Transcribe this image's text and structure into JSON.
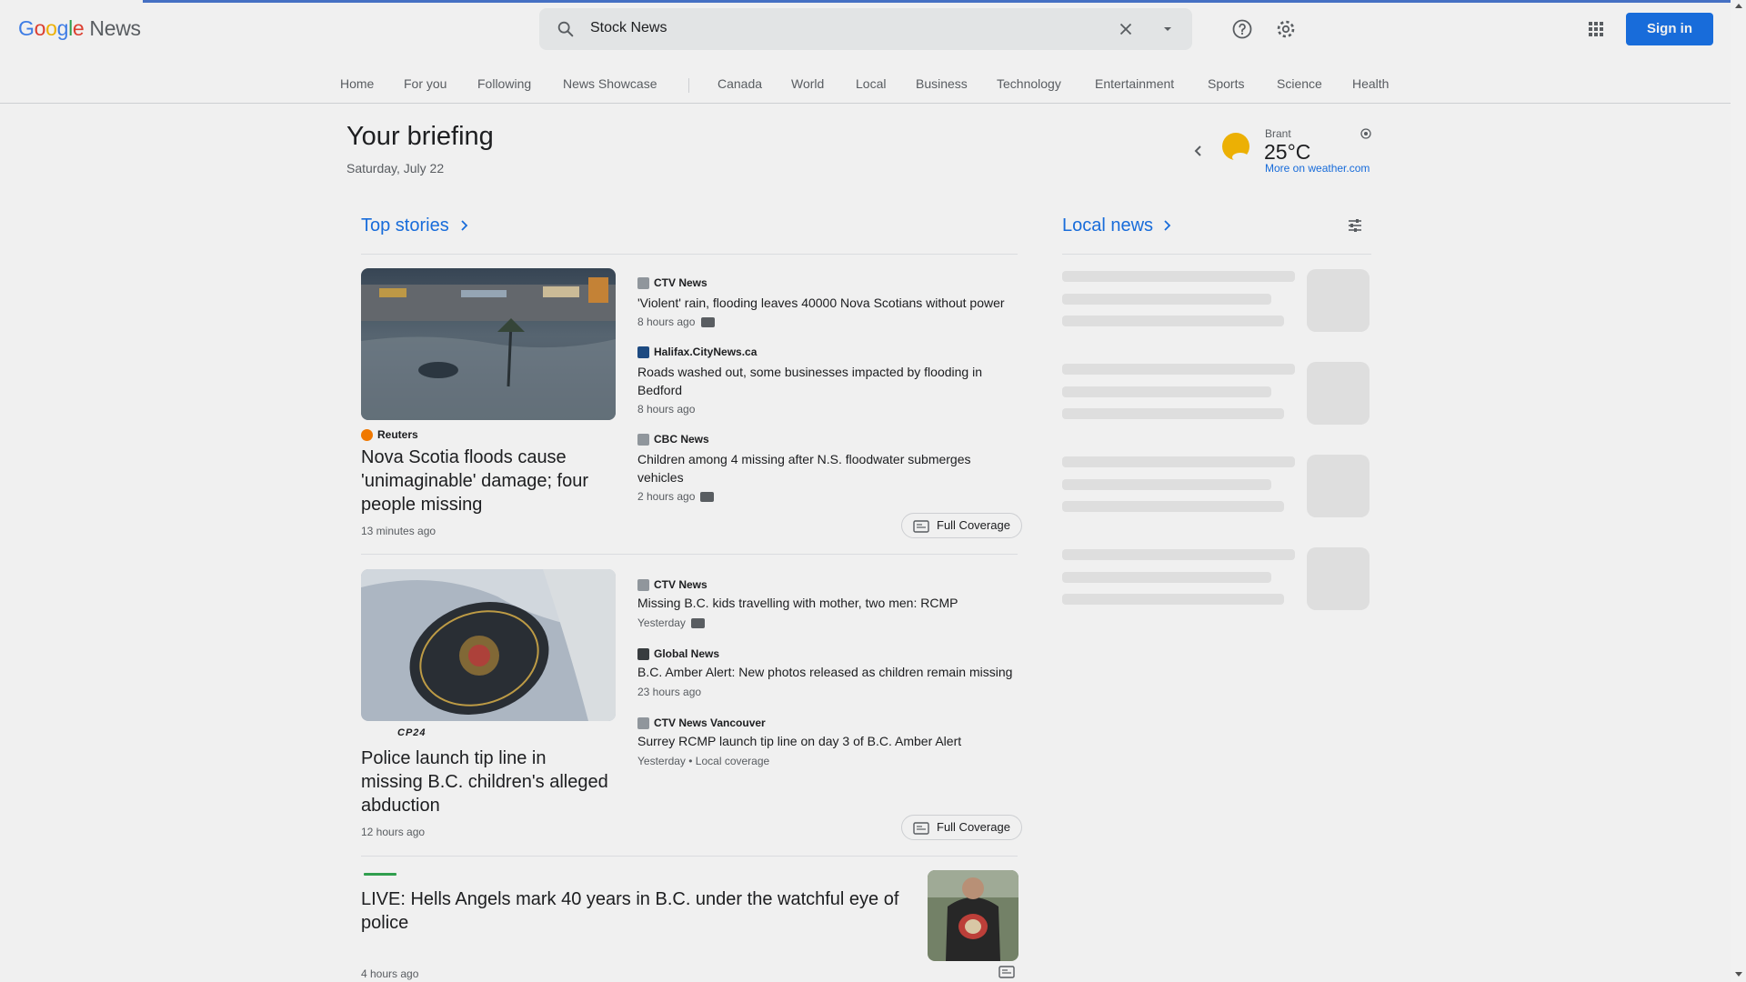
{
  "header": {
    "logo_letters": [
      "G",
      "o",
      "o",
      "g",
      "l",
      "e"
    ],
    "logo_news": "News",
    "search_value": "Stock News",
    "signin_label": "Sign in"
  },
  "nav": {
    "items": [
      "Home",
      "For you",
      "Following",
      "News Showcase",
      "Canada",
      "World",
      "Local",
      "Business",
      "Technology",
      "Entertainment",
      "Sports",
      "Science",
      "Health"
    ]
  },
  "briefing": {
    "title": "Your briefing",
    "date": "Saturday, July 22"
  },
  "weather": {
    "location": "Brant",
    "temperature": "25°C",
    "more_link": "More on weather.com"
  },
  "top_stories": {
    "title": "Top stories",
    "clusters": [
      {
        "lead": {
          "source": "Reuters",
          "title": "Nova Scotia floods cause 'unimaginable' damage; four people missing",
          "time": "13 minutes ago"
        },
        "related": [
          {
            "source": "CTV News",
            "title": "'Violent' rain, flooding leaves 40000 Nova Scotians without power",
            "time": "8 hours ago",
            "video": true
          },
          {
            "source": "Halifax.CityNews.ca",
            "title": "Roads washed out, some businesses impacted by flooding in Bedford",
            "time": "8 hours ago",
            "video": false
          },
          {
            "source": "CBC News",
            "title": "Children among 4 missing after N.S. floodwater submerges vehicles",
            "time": "2 hours ago",
            "video": true
          }
        ],
        "full_coverage": "Full Coverage"
      },
      {
        "lead": {
          "source": "CP24",
          "title": "Police launch tip line in missing B.C. children's alleged abduction",
          "time": "12 hours ago"
        },
        "related": [
          {
            "source": "CTV News",
            "title": "Missing B.C. kids travelling with mother, two men: RCMP",
            "time": "Yesterday",
            "video": true
          },
          {
            "source": "Global News",
            "title": "B.C. Amber Alert: New photos released as children remain missing",
            "time": "23 hours ago",
            "video": false
          },
          {
            "source": "CTV News Vancouver",
            "title": "Surrey RCMP launch tip line on day 3 of B.C. Amber Alert",
            "time": "Yesterday • Local coverage",
            "video": false
          }
        ],
        "full_coverage": "Full Coverage"
      },
      {
        "lead": {
          "title": "LIVE: Hells Angels mark 40 years in B.C. under the watchful eye of police",
          "time": "4 hours ago"
        }
      }
    ]
  },
  "local_news": {
    "title": "Local news"
  },
  "colors": {
    "accent": "#1a73e8",
    "text": "#202124",
    "muted": "#5f6368"
  }
}
